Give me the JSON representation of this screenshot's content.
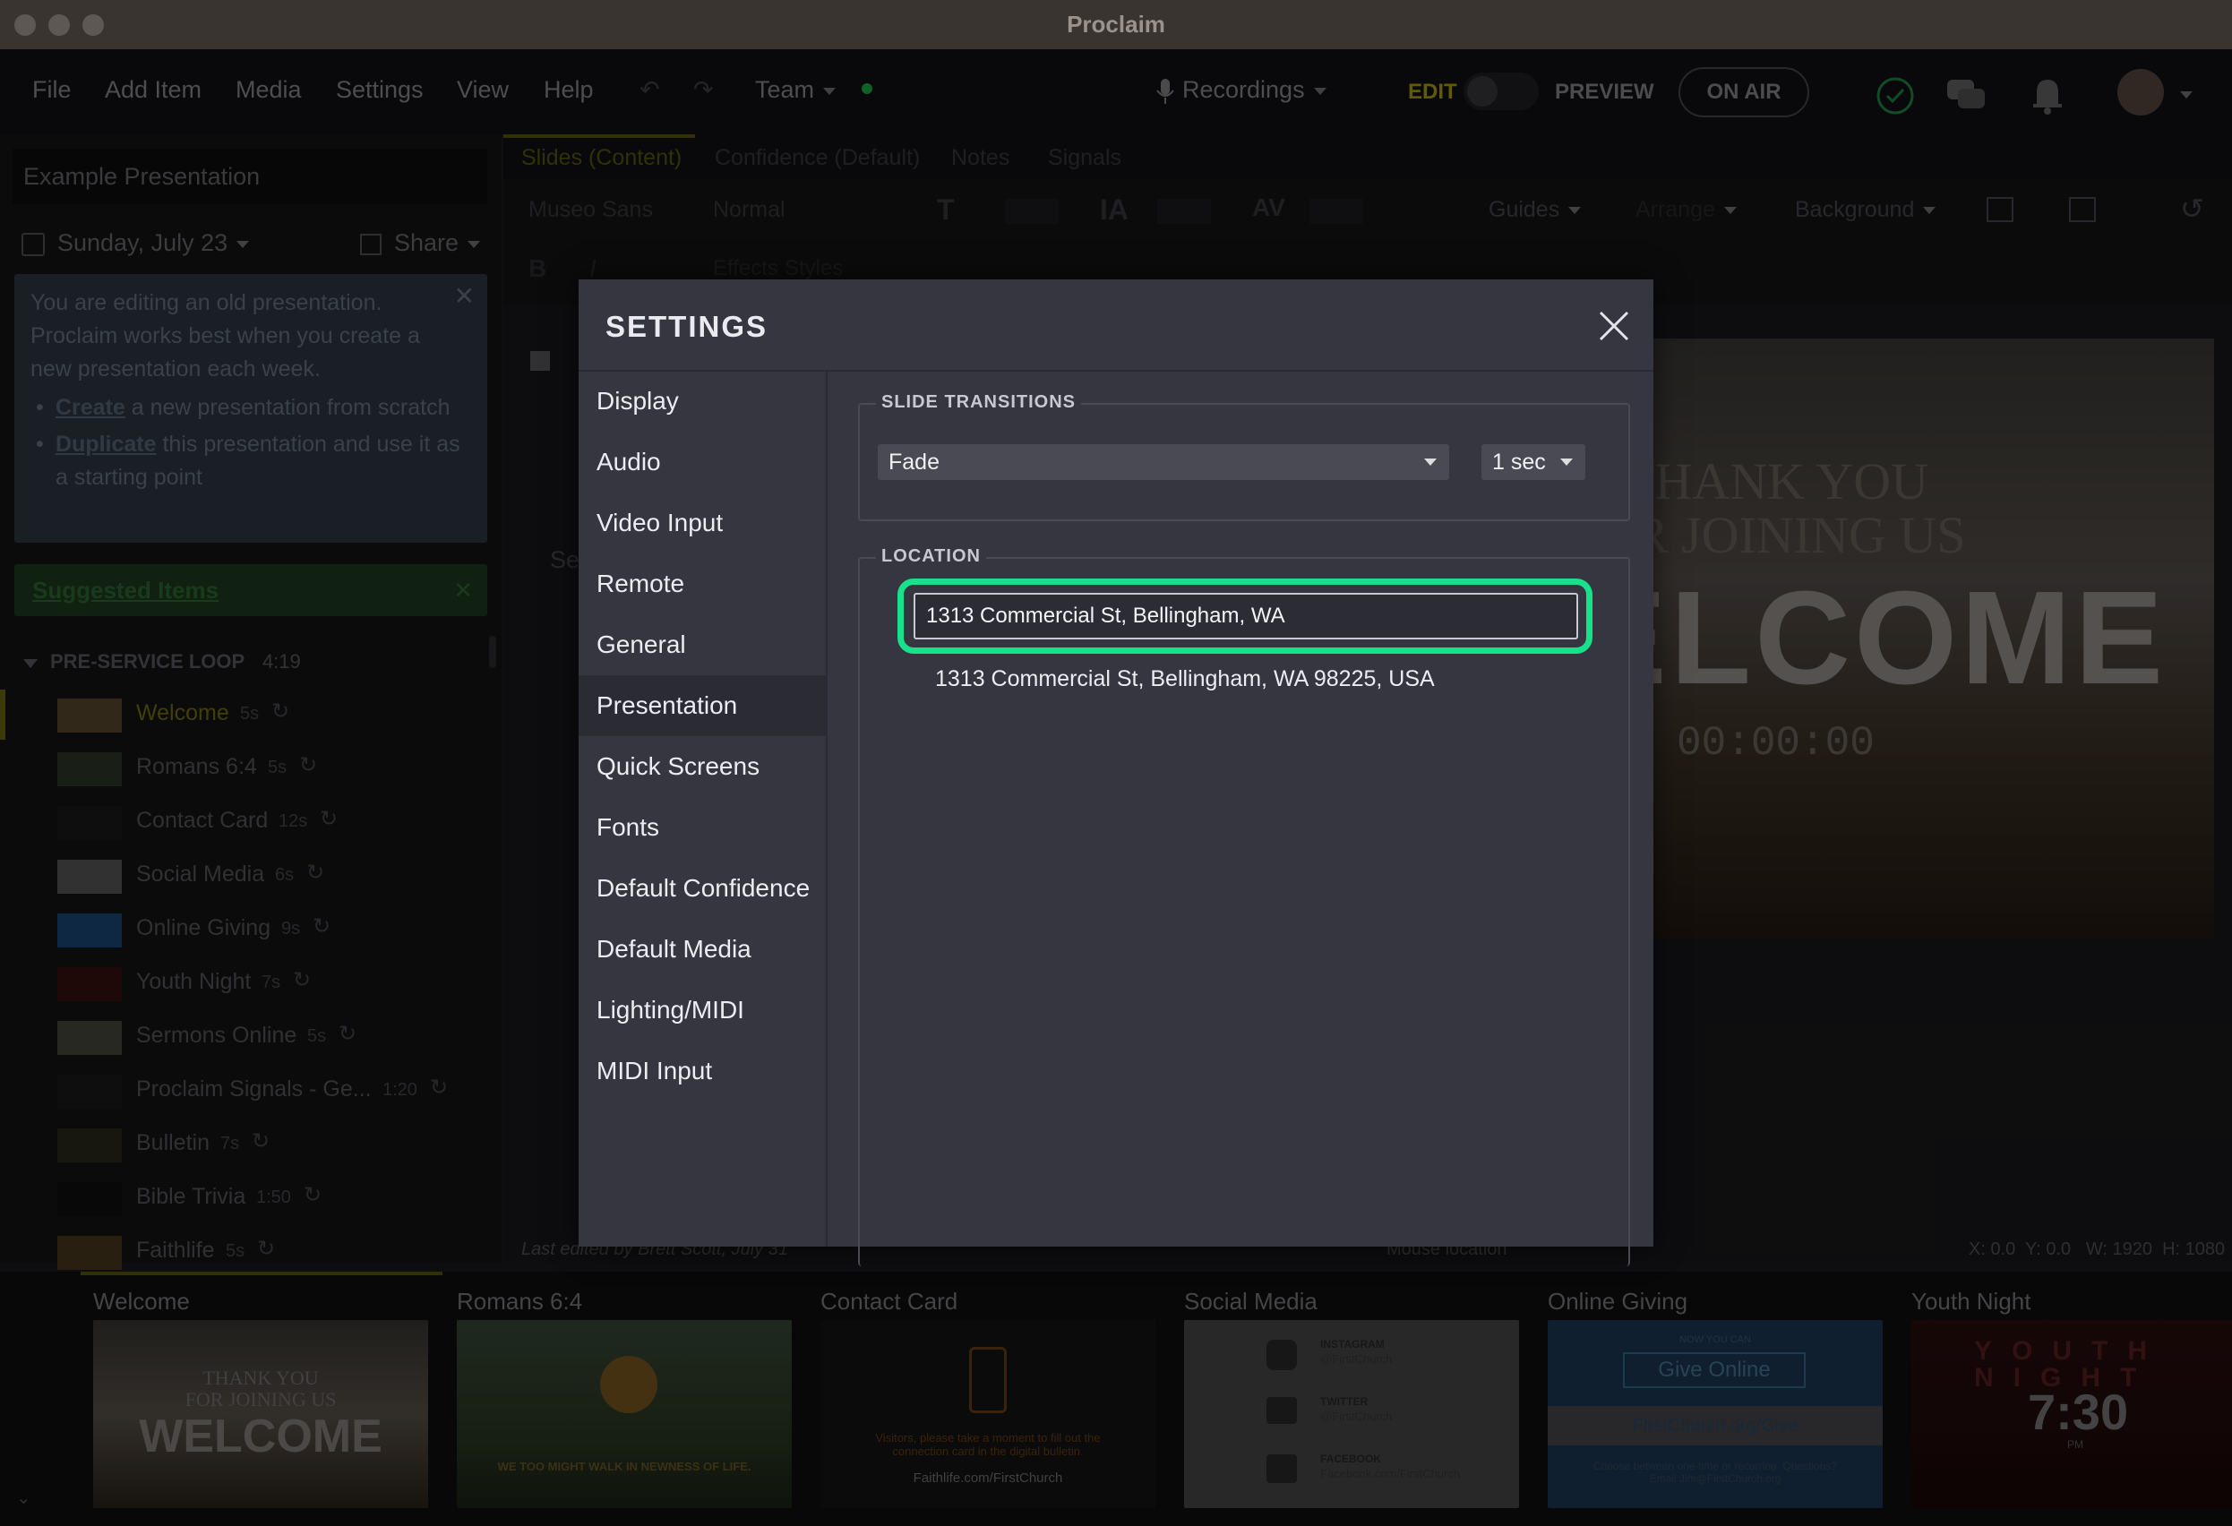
{
  "window": {
    "title": "Proclaim"
  },
  "menu": {
    "items": [
      "File",
      "Add Item",
      "Media",
      "Settings",
      "View",
      "Help"
    ],
    "team": "Team",
    "recordings": "Recordings",
    "edit": "EDIT",
    "preview": "PREVIEW",
    "on_air": "ON AIR"
  },
  "sidebar": {
    "presentation_name": "Example Presentation",
    "date": "Sunday, July 23",
    "share": "Share",
    "notice": {
      "line1": "You are editing an old presentation. Proclaim works best when you create a new presentation each week.",
      "create_link": "Create",
      "create_rest": " a new presentation from scratch",
      "duplicate_link": "Duplicate",
      "duplicate_rest": " this presentation and use it as a starting point"
    },
    "suggested": "Suggested Items",
    "section": {
      "name": "PRE-SERVICE LOOP",
      "duration": "4:19"
    },
    "items": [
      {
        "name": "Welcome",
        "duration": "5s"
      },
      {
        "name": "Romans 6:4",
        "duration": "5s"
      },
      {
        "name": "Contact Card",
        "duration": "12s"
      },
      {
        "name": "Social Media",
        "duration": "6s"
      },
      {
        "name": "Online Giving",
        "duration": "9s"
      },
      {
        "name": "Youth Night",
        "duration": "7s"
      },
      {
        "name": "Sermons Online",
        "duration": "5s"
      },
      {
        "name": "Proclaim Signals - Ge...",
        "duration": "1:20"
      },
      {
        "name": "Bulletin",
        "duration": "7s"
      },
      {
        "name": "Bible Trivia",
        "duration": "1:50"
      },
      {
        "name": "Faithlife",
        "duration": "5s"
      }
    ]
  },
  "editor": {
    "tabs": [
      "Slides (Content)",
      "Confidence (Default)",
      "Notes",
      "Signals"
    ],
    "toolbar": {
      "font": "Museo Sans",
      "weight": "Normal",
      "guides": "Guides",
      "arrange": "Arrange",
      "background": "Background",
      "effects": "Effects",
      "styles": "Styles"
    },
    "slide_text": {
      "line1": "THANK YOU",
      "line2": "OR JOINING US",
      "big": "ELCOME",
      "timer": "00:00:00"
    },
    "status": {
      "last_edited": "Last edited by Brett Scott, July 31",
      "mouse": "Mouse location",
      "coords": "X: 0.0  Y: 0.0   W: 1920  H: 1080"
    },
    "partial_label": "Se"
  },
  "strip": {
    "thumbs": [
      {
        "label": "Welcome",
        "l1": "THANK YOU",
        "l2": "FOR JOINING US",
        "big": "WELCOME"
      },
      {
        "label": "Romans 6:4",
        "caption": "WE TOO MIGHT WALK IN NEWNESS OF LIFE."
      },
      {
        "label": "Contact Card",
        "caption": "Visitors, please take a moment to fill out the connection card in the digital bulletin.",
        "url": "Faithlife.com/FirstChurch"
      },
      {
        "label": "Social Media",
        "rows": [
          {
            "t": "INSTAGRAM",
            "h": "@FirstChurch"
          },
          {
            "t": "TWITTER",
            "h": "@FirstChurch"
          },
          {
            "t": "FACEBOOK",
            "h": "Facebook.com/FirstChurch"
          }
        ]
      },
      {
        "label": "Online Giving",
        "small": "NOW YOU CAN",
        "button": "Give Online",
        "url": "FirstChurch.org/Give",
        "foot": "Choose between one-time or recurring. Questions? Email Jim@FirstChurch.org"
      },
      {
        "label": "Youth Night",
        "title": "YOUTH NIGHT",
        "time": "7:30",
        "pm": "PM"
      }
    ]
  },
  "settings": {
    "title": "SETTINGS",
    "nav": [
      "Display",
      "Audio",
      "Video Input",
      "Remote",
      "General",
      "Presentation",
      "Quick Screens",
      "Fonts",
      "Default Confidence",
      "Default Media",
      "Lighting/MIDI",
      "MIDI Input"
    ],
    "selected": "Presentation",
    "slide_transitions": {
      "legend": "SLIDE TRANSITIONS",
      "type": "Fade",
      "duration": "1 sec"
    },
    "location": {
      "legend": "LOCATION",
      "value": "1313 Commercial St, Bellingham, WA",
      "suggestion": "1313 Commercial St, Bellingham, WA 98225, USA"
    },
    "colors": {
      "focus_ring": "#19e08a",
      "modal_bg": "#363641"
    }
  }
}
